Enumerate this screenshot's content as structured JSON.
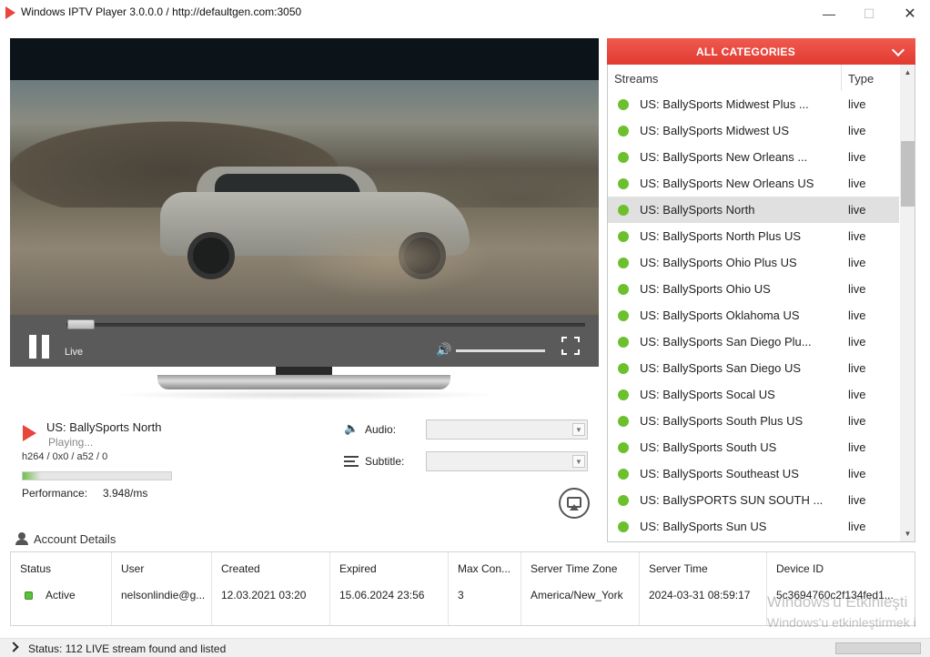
{
  "window": {
    "title": "Windows IPTV Player 3.0.0.0 / http://defaultgen.com:3050",
    "minimize_glyph": "—",
    "maximize_glyph": "☐",
    "close_glyph": "✕"
  },
  "player": {
    "live_label": "Live",
    "seek_progress": 0.05,
    "volume_level": 1.0
  },
  "now_playing": {
    "title": "US: BallySports North",
    "status": "Playing...",
    "codec": "h264 / 0x0 / a52  / 0",
    "performance_label": "Performance:",
    "performance_value": "3.948/ms",
    "performance_fill": 0.12
  },
  "tracks": {
    "audio_label": "Audio:",
    "audio_value": "",
    "subtitle_label": "Subtitle:",
    "subtitle_value": ""
  },
  "categories": {
    "selected": "ALL CATEGORIES"
  },
  "streams": {
    "col_streams": "Streams",
    "col_type": "Type",
    "rows": [
      {
        "name": "US: BallySports Midwest Plus ...",
        "type": "live"
      },
      {
        "name": "US: BallySports Midwest US",
        "type": "live"
      },
      {
        "name": "US: BallySports New Orleans ...",
        "type": "live"
      },
      {
        "name": "US: BallySports New Orleans US",
        "type": "live"
      },
      {
        "name": "US: BallySports North",
        "type": "live",
        "selected": true
      },
      {
        "name": "US: BallySports North Plus US",
        "type": "live"
      },
      {
        "name": "US: BallySports Ohio Plus US",
        "type": "live"
      },
      {
        "name": "US: BallySports Ohio US",
        "type": "live"
      },
      {
        "name": "US: BallySports Oklahoma US",
        "type": "live"
      },
      {
        "name": "US: BallySports San Diego Plu...",
        "type": "live"
      },
      {
        "name": "US: BallySports San Diego US",
        "type": "live"
      },
      {
        "name": "US: BallySports Socal US",
        "type": "live"
      },
      {
        "name": "US: BallySports South Plus US",
        "type": "live"
      },
      {
        "name": "US: BallySports South US",
        "type": "live"
      },
      {
        "name": "US: BallySports Southeast US",
        "type": "live"
      },
      {
        "name": "US: BallySPORTS SUN SOUTH ...",
        "type": "live"
      },
      {
        "name": "US: BallySports Sun US",
        "type": "live"
      }
    ]
  },
  "account": {
    "title": "Account Details",
    "columns": [
      {
        "header": "Status",
        "value": "Active"
      },
      {
        "header": "User",
        "value": "nelsonlindie@g..."
      },
      {
        "header": "Created",
        "value": "12.03.2021 03:20"
      },
      {
        "header": "Expired",
        "value": "15.06.2024 23:56"
      },
      {
        "header": "Max Con...",
        "value": "3"
      },
      {
        "header": "Server Time Zone",
        "value": "America/New_York"
      },
      {
        "header": "Server Time",
        "value": "2024-03-31 08:59:17"
      },
      {
        "header": "Device ID",
        "value": "5c3694760c2f134fed1..."
      }
    ]
  },
  "watermark": {
    "line1": "Windows'u Etkinleşti",
    "line2": "Windows'u etkinleştirmek i"
  },
  "status": {
    "text": "Status: 112 LIVE stream found and listed"
  },
  "colors": {
    "accent": "#e13a30",
    "live_dot": "#6cc02e"
  }
}
